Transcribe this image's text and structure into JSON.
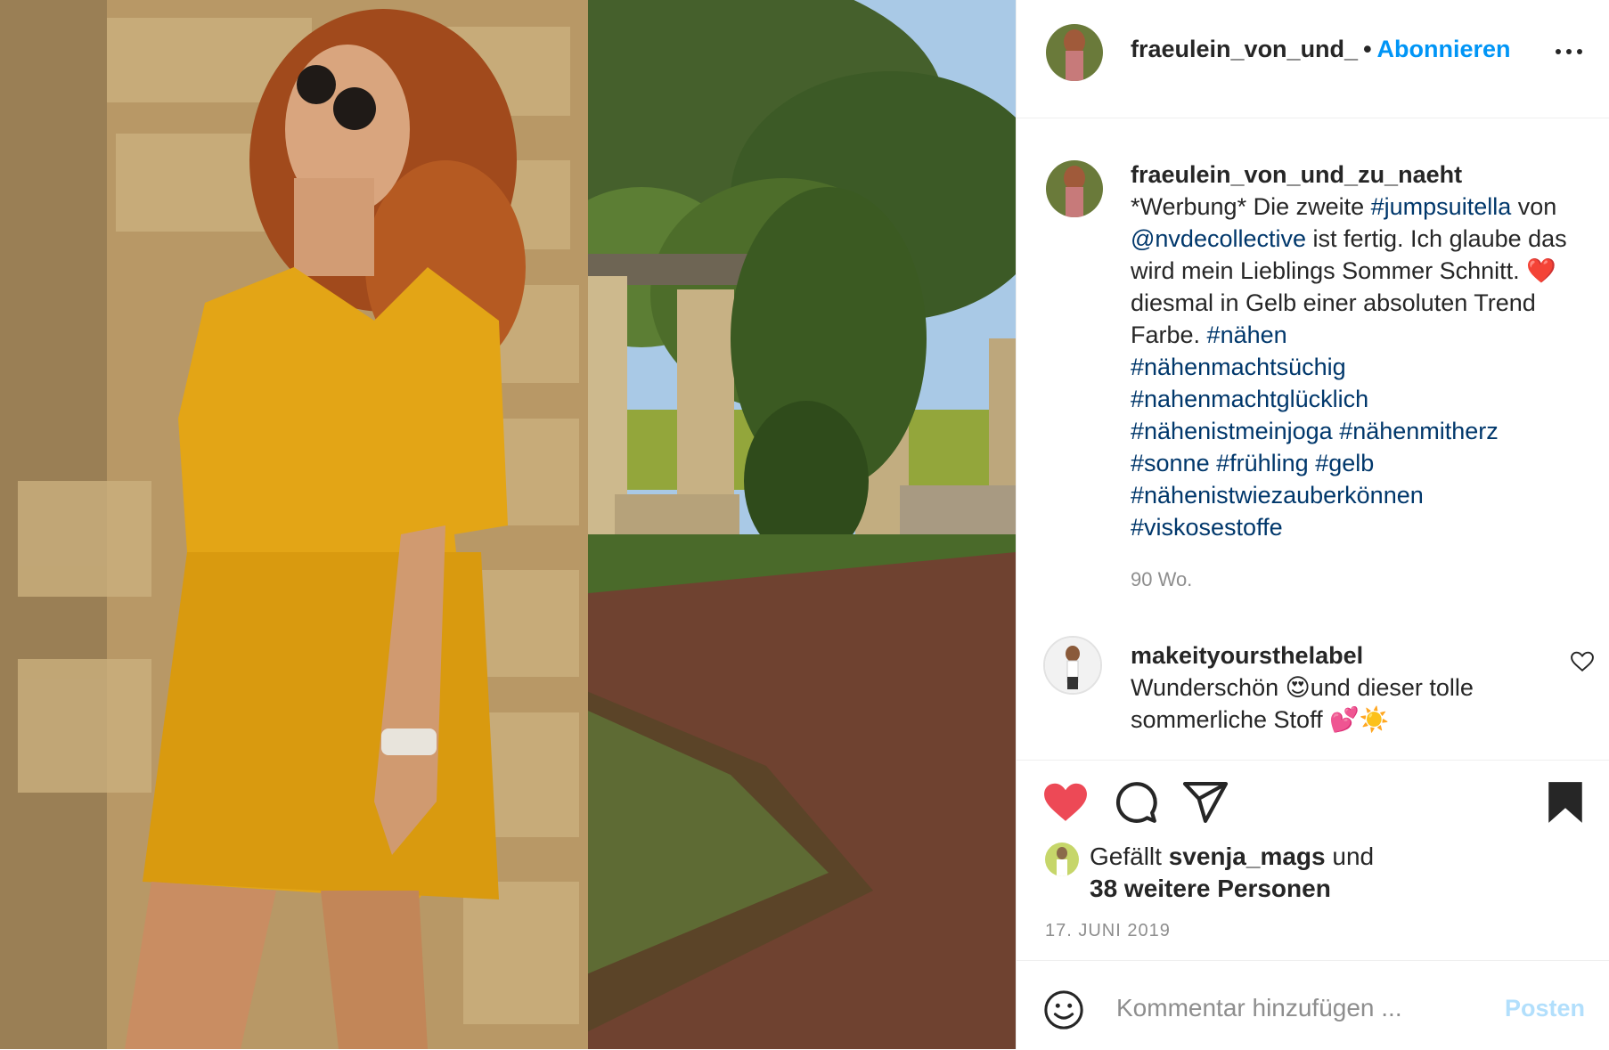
{
  "header": {
    "username": "fraeulein_von_und_",
    "separator": "•",
    "follow_label": "Abonnieren"
  },
  "caption": {
    "username": "fraeulein_von_und_zu_naeht",
    "text_1": "*Werbung* Die zweite ",
    "tag_1": "#jumpsuitella",
    "text_2": " von ",
    "tag_2": "@nvdecollective",
    "text_3": " ist fertig. Ich glaube das wird mein Lieblings Sommer Schnitt. ",
    "emoji_heart": "❤️",
    "text_4": "diesmal in Gelb einer absoluten Trend Farbe. ",
    "tags": [
      "#nähen",
      "#nähenmachtsüchig",
      "#nahenmachtglücklich",
      "#nähenistmeinjoga",
      "#nähenmitherz",
      "#sonne",
      "#frühling",
      "#gelb",
      "#nähenistwiezauberkönnen",
      "#viskosestoffe"
    ],
    "time": "90 Wo."
  },
  "comment": {
    "username": "makeityoursthelabel",
    "text_1": "Wunderschön ",
    "emoji_1": "😍",
    "text_2": "und dieser tolle sommerliche Stoff ",
    "emoji_2": "💕",
    "emoji_3": "☀️"
  },
  "likes": {
    "prefix": "Gefällt ",
    "user": "svenja_mags",
    "middle": " und",
    "others": "38 weitere Personen"
  },
  "date": "17. JUNI 2019",
  "composer": {
    "placeholder": "Kommentar hinzufügen ...",
    "post_label": "Posten"
  },
  "icons": {
    "like": "heart-filled-icon",
    "comment": "speech-bubble-icon",
    "share": "paper-plane-icon",
    "save": "bookmark-filled-icon",
    "more": "ellipsis-icon",
    "emoji": "smiley-icon"
  },
  "colors": {
    "like_red": "#ed4956",
    "link_blue": "#0095f6",
    "hashtag_navy": "#00376b",
    "post_disabled": "#b2dffc",
    "muted": "#8e8e8e"
  }
}
